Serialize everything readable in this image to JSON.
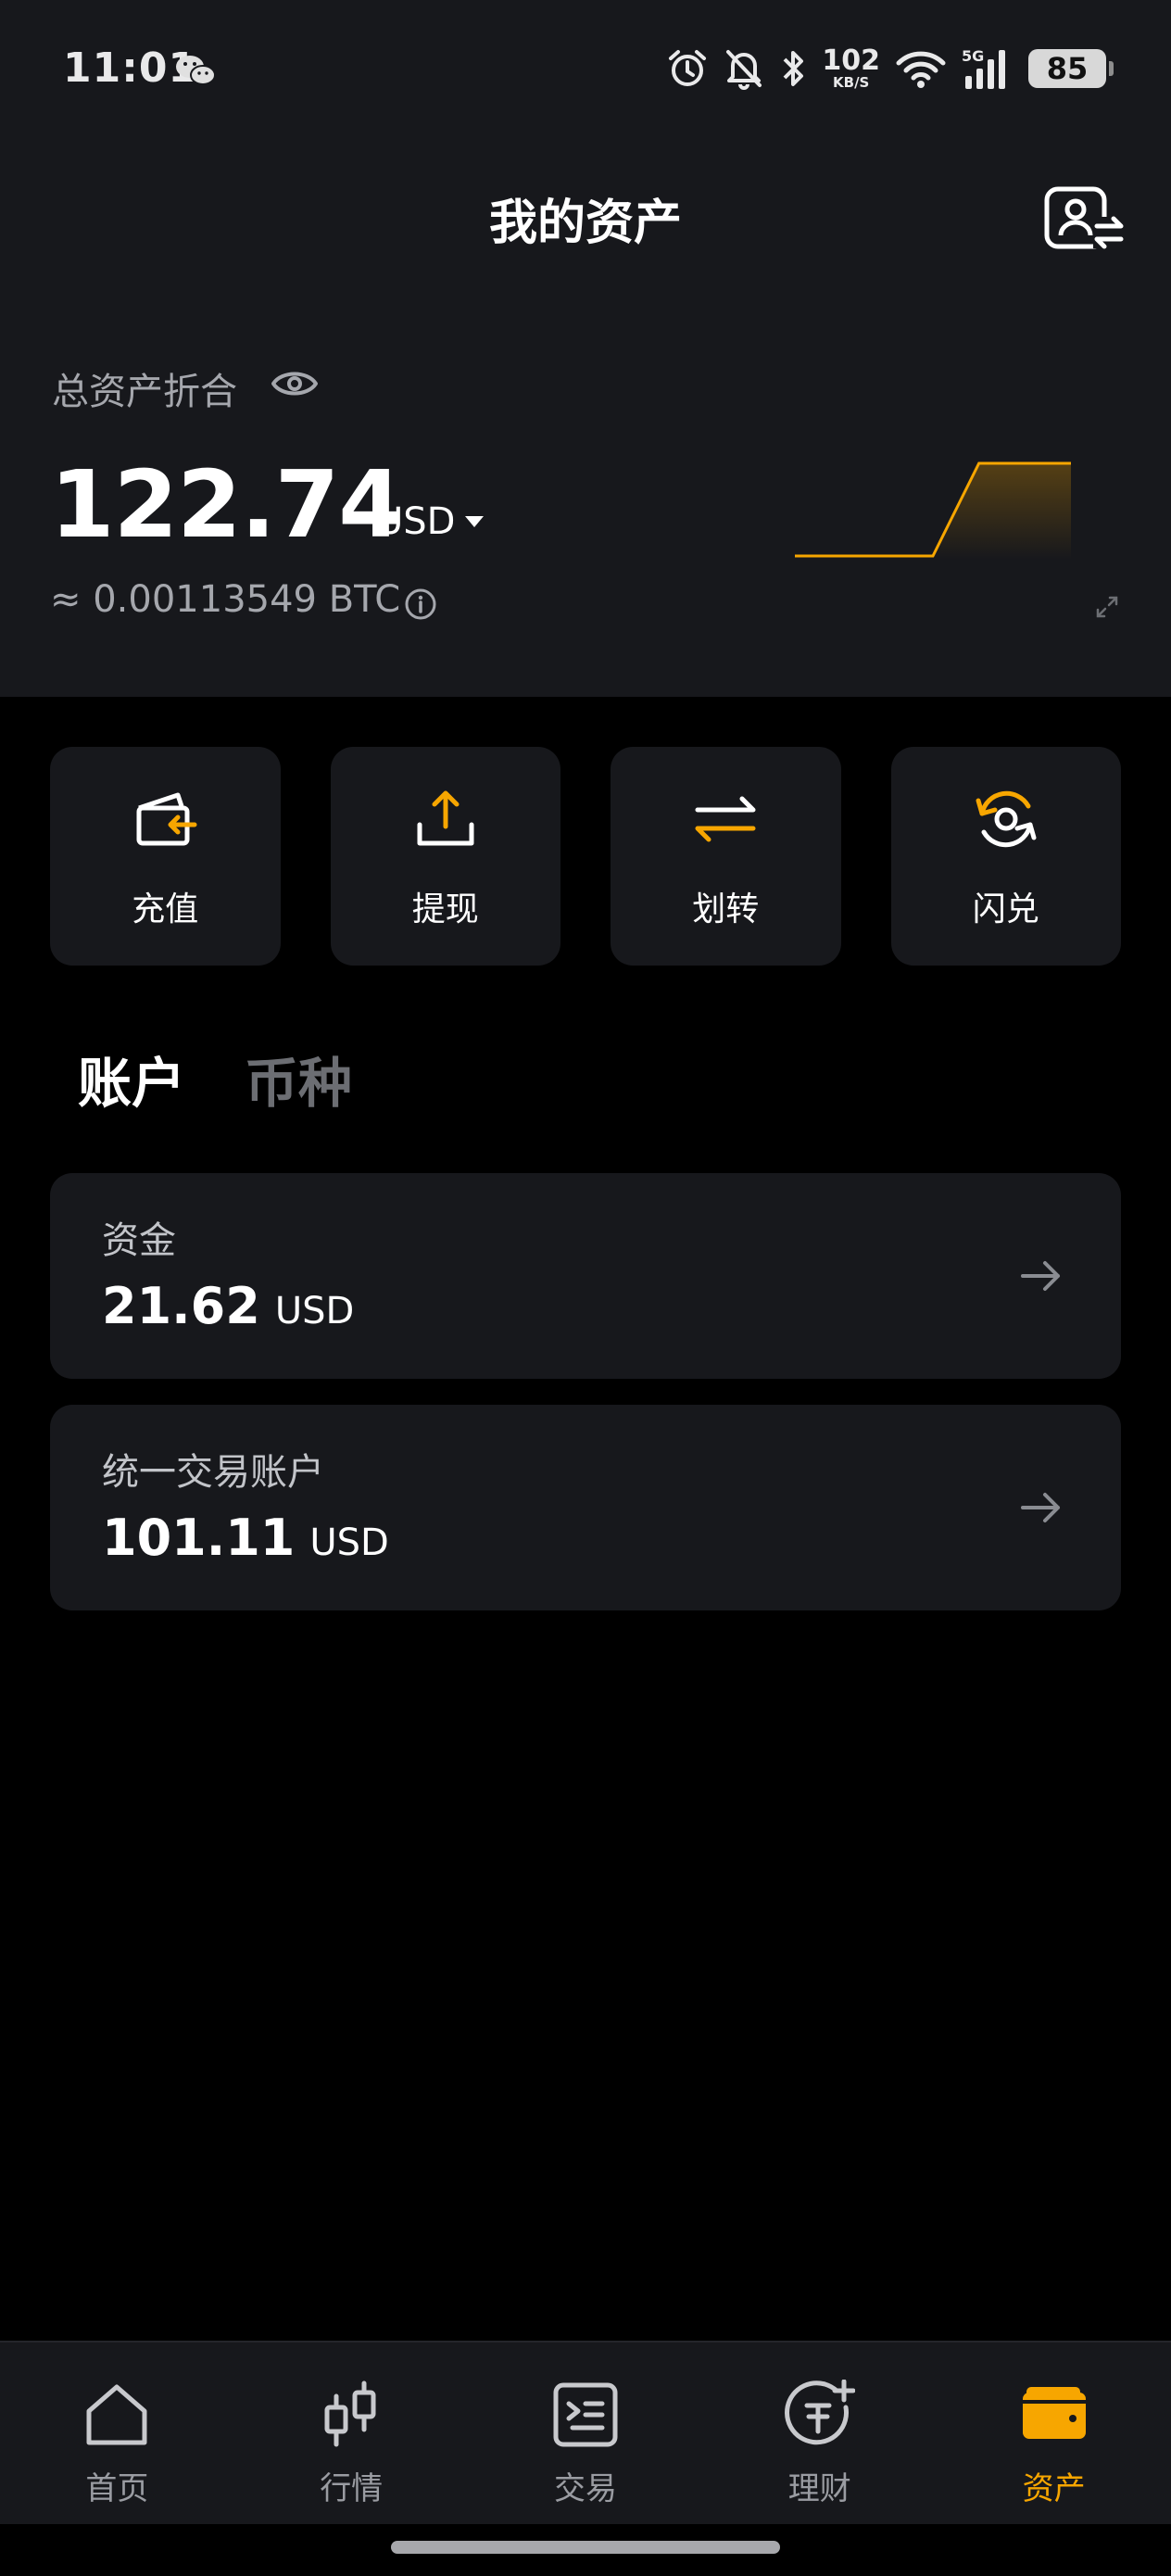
{
  "status_bar": {
    "time": "11:01",
    "net_speed_value": "102",
    "net_speed_unit": "KB/S",
    "network_type": "5G",
    "battery": "85",
    "icons": [
      "wechat-icon",
      "alarm-icon",
      "bell-off-icon",
      "bluetooth-icon",
      "wifi-icon",
      "signal-icon",
      "battery-icon"
    ]
  },
  "header": {
    "title": "我的资产"
  },
  "summary": {
    "total_label": "总资产折合",
    "total_value": "122.74",
    "currency": "USD",
    "btc_approx": "≈ 0.00113549 BTC",
    "trend": [
      0,
      0,
      0,
      0,
      1,
      1,
      1
    ]
  },
  "actions": [
    {
      "label": "充值",
      "icon": "deposit-icon"
    },
    {
      "label": "提现",
      "icon": "withdraw-icon"
    },
    {
      "label": "划转",
      "icon": "transfer-icon"
    },
    {
      "label": "闪兑",
      "icon": "convert-icon"
    }
  ],
  "tabs": [
    {
      "label": "账户",
      "active": true
    },
    {
      "label": "币种",
      "active": false
    }
  ],
  "accounts": [
    {
      "name": "资金",
      "value": "21.62",
      "currency": "USD"
    },
    {
      "name": "统一交易账户",
      "value": "101.11",
      "currency": "USD"
    }
  ],
  "bottom_nav": [
    {
      "label": "首页",
      "icon": "home-icon",
      "active": false
    },
    {
      "label": "行情",
      "icon": "candlestick-icon",
      "active": false
    },
    {
      "label": "交易",
      "icon": "trade-icon",
      "active": false
    },
    {
      "label": "理财",
      "icon": "earn-icon",
      "active": false
    },
    {
      "label": "资产",
      "icon": "wallet-icon",
      "active": true
    }
  ],
  "colors": {
    "accent": "#f7a600",
    "surface": "#17181c",
    "background": "#000000",
    "muted_text": "#a5a7ad"
  }
}
